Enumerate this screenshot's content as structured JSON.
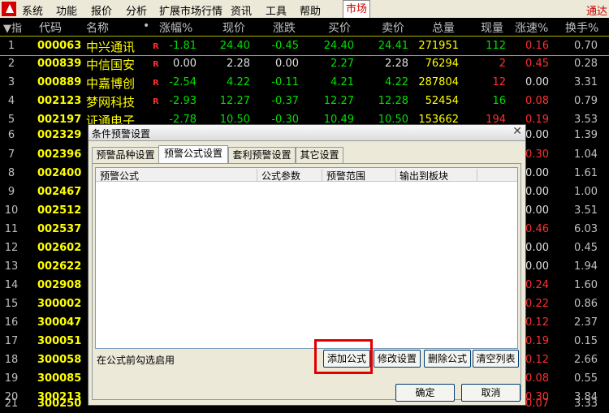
{
  "menubar": {
    "items": [
      "系统",
      "功能",
      "报价",
      "分析",
      "扩展市场行情",
      "资讯",
      "工具",
      "帮助"
    ],
    "market_tab": "市场",
    "right_tab": "通达"
  },
  "table": {
    "headers": [
      "▼指",
      "代码",
      "名称",
      "•",
      "涨幅%",
      "现价",
      "涨跌",
      "买价",
      "卖价",
      "总量",
      "现量",
      "涨速%",
      "换手%"
    ],
    "rows": [
      {
        "idx": "1",
        "code": "000063",
        "name": "中兴通讯",
        "flag": "R",
        "chg": "-1.81",
        "price": "24.40",
        "diff": "-0.45",
        "buy": "24.40",
        "sell": "24.41",
        "vol": "271951",
        "now": "112",
        "speed": "0.16",
        "turn": "0.70"
      },
      {
        "idx": "2",
        "code": "000839",
        "name": "中信国安",
        "flag": "R",
        "chg": "0.00",
        "price": "2.28",
        "diff": "0.00",
        "buy": "2.27",
        "sell": "2.28",
        "vol": "76294",
        "now": "2",
        "speed": "0.45",
        "turn": "0.28"
      },
      {
        "idx": "3",
        "code": "000889",
        "name": "中嘉博创",
        "flag": "R",
        "chg": "-2.54",
        "price": "4.22",
        "diff": "-0.11",
        "buy": "4.21",
        "sell": "4.22",
        "vol": "287804",
        "now": "12",
        "speed": "0.00",
        "turn": "3.31"
      },
      {
        "idx": "4",
        "code": "002123",
        "name": "梦网科技",
        "flag": "R",
        "chg": "-2.93",
        "price": "12.27",
        "diff": "-0.37",
        "buy": "12.27",
        "sell": "12.28",
        "vol": "52454",
        "now": "16",
        "speed": "0.08",
        "turn": "0.79"
      },
      {
        "idx": "5",
        "code": "002197",
        "name": "证通电子",
        "flag": "",
        "chg": "-2.78",
        "price": "10.50",
        "diff": "-0.30",
        "buy": "10.49",
        "sell": "10.50",
        "vol": "153662",
        "now": "194",
        "speed": "0.19",
        "turn": "3.53"
      },
      {
        "idx": "6",
        "code": "002329",
        "speed": "0.00",
        "turn": "1.39"
      },
      {
        "idx": "7",
        "code": "002396",
        "speed": "0.30",
        "turn": "1.04"
      },
      {
        "idx": "8",
        "code": "002400",
        "speed": "0.00",
        "turn": "1.61"
      },
      {
        "idx": "9",
        "code": "002467",
        "speed": "0.00",
        "turn": "1.00"
      },
      {
        "idx": "10",
        "code": "002512",
        "speed": "0.00",
        "turn": "3.51"
      },
      {
        "idx": "11",
        "code": "002537",
        "speed": "0.46",
        "turn": "6.03"
      },
      {
        "idx": "12",
        "code": "002602",
        "speed": "0.00",
        "turn": "0.45"
      },
      {
        "idx": "13",
        "code": "002622",
        "speed": "0.00",
        "turn": "1.94"
      },
      {
        "idx": "14",
        "code": "002908",
        "speed": "0.24",
        "turn": "1.60"
      },
      {
        "idx": "15",
        "code": "300002",
        "speed": "0.22",
        "turn": "0.86"
      },
      {
        "idx": "16",
        "code": "300047",
        "speed": "0.12",
        "turn": "2.37"
      },
      {
        "idx": "17",
        "code": "300051",
        "speed": "0.19",
        "turn": "0.15"
      },
      {
        "idx": "18",
        "code": "300058",
        "speed": "0.12",
        "turn": "2.66"
      },
      {
        "idx": "19",
        "code": "300085",
        "speed": "0.08",
        "turn": "0.55"
      },
      {
        "idx": "20",
        "code": "300213",
        "speed": "0.30",
        "turn": "3.84"
      },
      {
        "idx": "21",
        "code": "300250",
        "speed": "0.07",
        "turn": "3.33"
      }
    ]
  },
  "dialog": {
    "title": "条件预警设置",
    "tabs": [
      "预警品种设置",
      "预警公式设置",
      "套利预警设置",
      "其它设置"
    ],
    "columns": [
      "预警公式",
      "公式参数",
      "预警范围",
      "输出到板块"
    ],
    "hint": "在公式前勾选启用",
    "buttons": {
      "add": "添加公式",
      "modify": "修改设置",
      "delete": "删除公式",
      "clear": "清空列表",
      "ok": "确定",
      "cancel": "取消"
    }
  }
}
